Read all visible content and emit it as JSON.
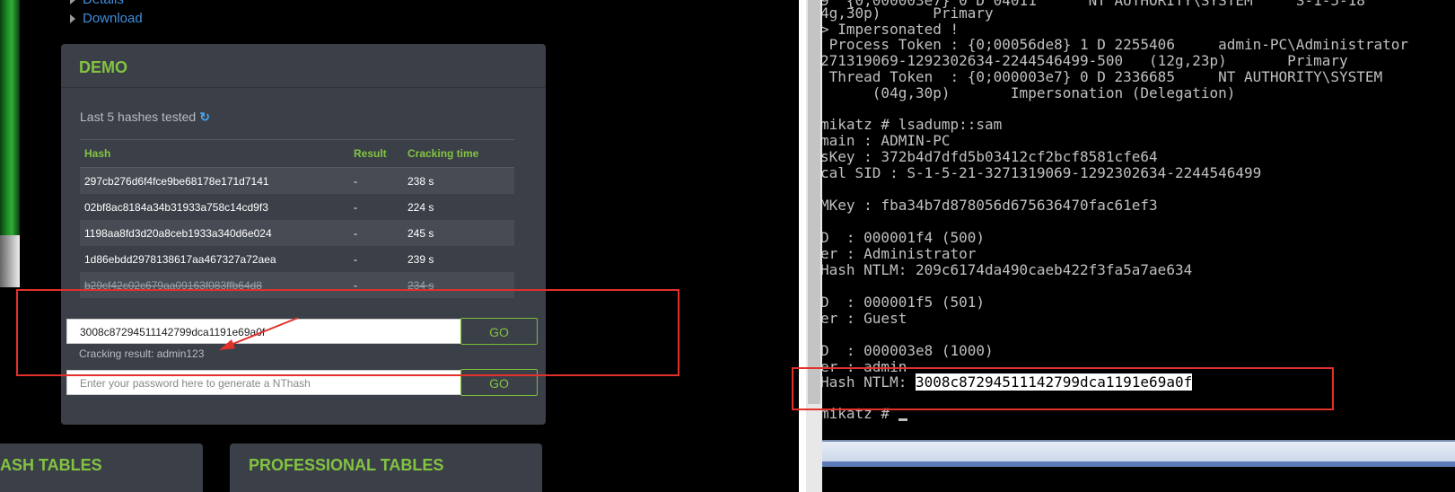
{
  "web": {
    "nav_details": "Details",
    "nav_download": "Download",
    "demo_title": "DEMO",
    "last5_label": "Last 5 hashes tested",
    "refresh_icon": "refresh-icon",
    "table": {
      "headers": [
        "Hash",
        "Result",
        "Cracking time"
      ],
      "rows": [
        {
          "hash": "297cb276d6f4fce9be68178e171d7141",
          "result": "-",
          "time": "238 s"
        },
        {
          "hash": "02bf8ac8184a34b31933a758c14cd9f3",
          "result": "-",
          "time": "224 s"
        },
        {
          "hash": "1198aa8fd3d20a8ceb1933a340d6e024",
          "result": "-",
          "time": "245 s"
        },
        {
          "hash": "1d86ebdd2978138617aa467327a72aea",
          "result": "-",
          "time": "239 s"
        },
        {
          "hash": "b29cf42c02c679aa09163f083ffb64d8",
          "result": "-",
          "time": "234 s"
        }
      ]
    },
    "hash_input_value": "3008c87294511142799dca1191e69a0f",
    "go_label": "GO",
    "cracking_result": "Cracking result: admin123",
    "password_placeholder": "Enter your password here to generate a NThash",
    "card_hash_tables": "ASH TABLES",
    "card_professional_tables": "PROFESSIONAL TABLES"
  },
  "console": {
    "lines": [
      "9  {0;000003e7} 0 D 04011      NT AUTHORITY\\SYSTEM     S-1-5-18",
      "4g,30p)      Primary",
      "> Impersonated !",
      " Process Token : {0;00056de8} 1 D 2255406     admin-PC\\Administrator",
      "271319069-1292302634-2244546499-500   (12g,23p)       Primary",
      " Thread Token  : {0;000003e7} 0 D 2336685     NT AUTHORITY\\SYSTEM",
      "      (04g,30p)       Impersonation (Delegation)",
      "",
      "mikatz # lsadump::sam",
      "main : ADMIN-PC",
      "sKey : 372b4d7dfd5b03412cf2bcf8581cfe64",
      "cal SID : S-1-5-21-3271319069-1292302634-2244546499",
      "",
      "MKey : fba34b7d878056d675636470fac61ef3",
      "",
      "D  : 000001f4 (500)",
      "er : Administrator",
      "Hash NTLM: 209c6174da490caeb422f3fa5a7ae634",
      "",
      "D  : 000001f5 (501)",
      "er : Guest",
      "",
      "D  : 000003e8 (1000)",
      "er : admin"
    ],
    "ntlm_prefix": "Hash NTLM: ",
    "ntlm_selected": "3008c87294511142799dca1191e69a0f",
    "prompt": "mikatz # "
  },
  "colors": {
    "accent_green": "#82c341",
    "link_blue": "#3d8fe0",
    "panel_bg": "#3b4048",
    "highlight_red": "#e3302b"
  }
}
